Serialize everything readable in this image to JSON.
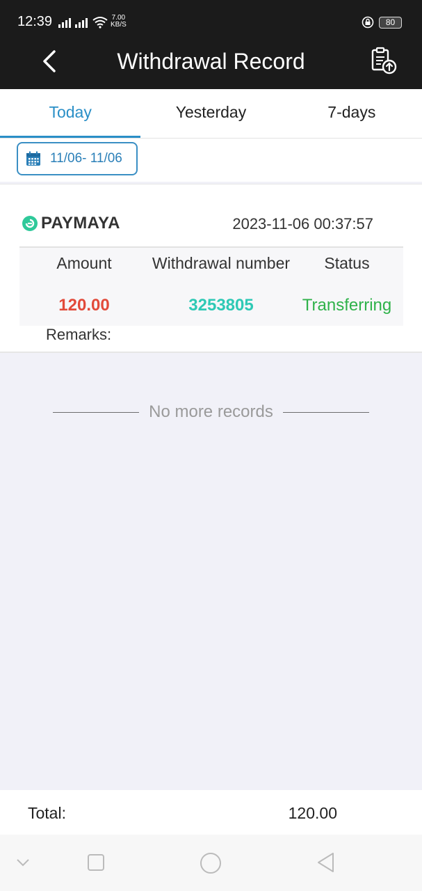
{
  "status_bar": {
    "time": "12:39",
    "net_speed": "7.00",
    "net_unit": "KB/S",
    "battery": "80"
  },
  "header": {
    "title": "Withdrawal Record"
  },
  "tabs": [
    {
      "label": "Today",
      "active": true
    },
    {
      "label": "Yesterday",
      "active": false
    },
    {
      "label": "7-days",
      "active": false
    }
  ],
  "date_filter": {
    "range": "11/06- 11/06"
  },
  "record": {
    "provider": "PAYMAYA",
    "datetime": "2023-11-06 00:37:57",
    "headers": {
      "amount": "Amount",
      "number": "Withdrawal number",
      "status": "Status"
    },
    "values": {
      "amount": "120.00",
      "number": "3253805",
      "status": "Transferring"
    },
    "remarks_label": "Remarks:"
  },
  "no_more": "No more records",
  "total": {
    "label": "Total:",
    "value": "120.00"
  },
  "colors": {
    "accent": "#2a8fc7",
    "amount": "#e24a3a",
    "number": "#2ec9b5",
    "status": "#2fb24a"
  },
  "icons": [
    "back-icon",
    "upload-record-icon",
    "calendar-icon",
    "paymaya-logo-icon"
  ]
}
